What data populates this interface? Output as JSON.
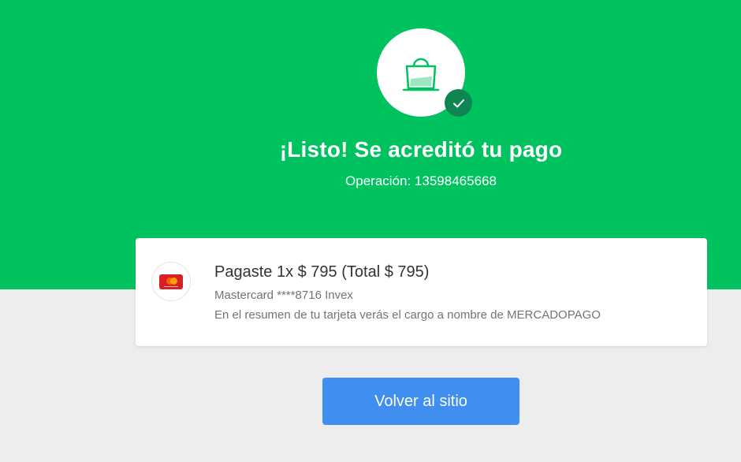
{
  "header": {
    "title": "¡Listo! Se acreditó tu pago",
    "operation_label": "Operación: 13598465668",
    "icons": {
      "bag": "shopping-bag-icon",
      "check": "check-icon"
    }
  },
  "payment_card": {
    "summary": "Pagaste 1x $ 795 (Total $ 795)",
    "card_info": "Mastercard ****8716 Invex",
    "statement_note": "En el resumen de tu tarjeta verás el cargo a nombre de MERCADOPAGO",
    "card_icon": "mastercard-icon"
  },
  "actions": {
    "back_label": "Volver al sitio"
  },
  "colors": {
    "hero_background": "#00c35f",
    "page_background": "#ededed",
    "check_badge": "#0e8552",
    "button": "#3f8ef0"
  }
}
